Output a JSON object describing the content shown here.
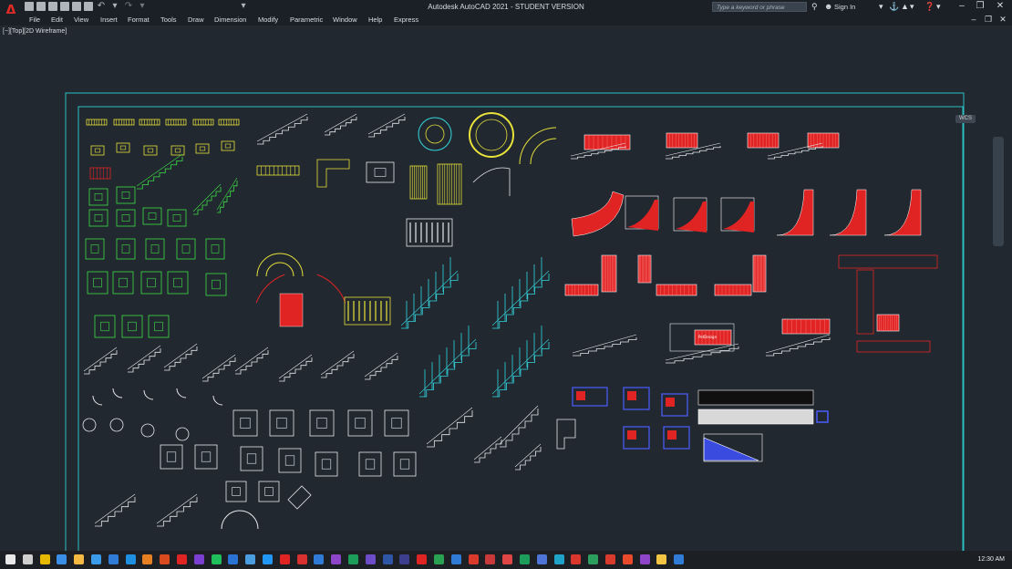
{
  "window": {
    "title": "Autodesk AutoCAD 2021 - STUDENT VERSION",
    "search_placeholder": "Type a keyword or phrase",
    "sign_in": "Sign In",
    "app_letter": "A"
  },
  "menu": [
    "File",
    "Edit",
    "View",
    "Insert",
    "Format",
    "Tools",
    "Draw",
    "Dimension",
    "Modify",
    "Parametric",
    "Window",
    "Help",
    "Express"
  ],
  "viewport": {
    "label": "[−][Top][2D Wireframe]"
  },
  "ucs": {
    "label": "WCS"
  },
  "drawing_labels": {
    "red_plate": "PetDesign"
  },
  "taskbar": {
    "time": "12:30 AM"
  },
  "colors": {
    "yellow": "#e8e23a",
    "green": "#3fe046",
    "cyan": "#35d6df",
    "red": "#e02424",
    "white": "#e6e9ee",
    "blue": "#4a5cff",
    "frame": "#2bc1c4"
  }
}
